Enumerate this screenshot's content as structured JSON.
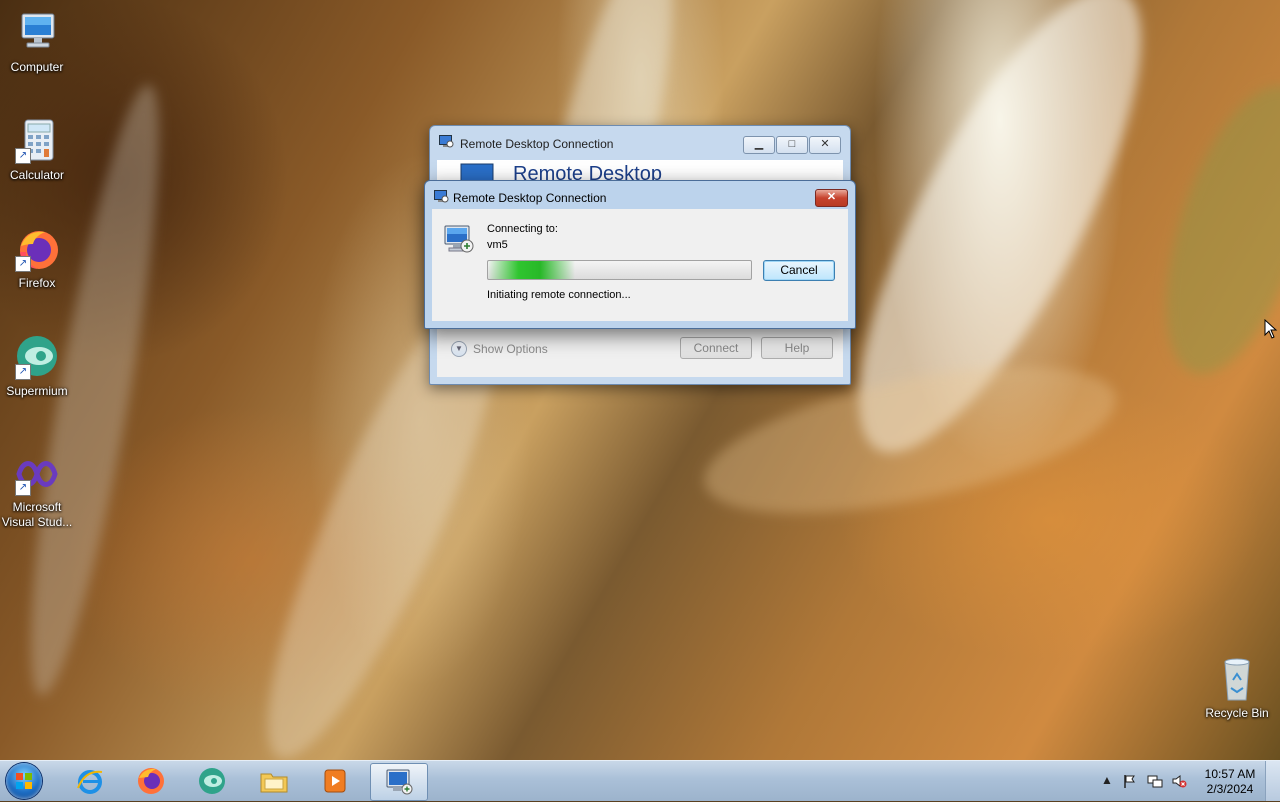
{
  "desktop": {
    "icons": [
      {
        "label": "Computer",
        "icon": "computer-icon"
      },
      {
        "label": "Calculator",
        "icon": "calculator-icon"
      },
      {
        "label": "Firefox",
        "icon": "firefox-icon"
      },
      {
        "label": "Supermium",
        "icon": "supermium-icon"
      },
      {
        "label": "Microsoft Visual Stud...",
        "label_line1": "Microsoft",
        "label_line2": "Visual Stud...",
        "icon": "visual-studio-icon"
      },
      {
        "label": "Recycle Bin",
        "icon": "recycle-bin-icon"
      }
    ]
  },
  "bg_window": {
    "title": "Remote Desktop Connection",
    "heading": "Remote Desktop",
    "show_options": "Show Options",
    "connect_label": "Connect",
    "help_label": "Help"
  },
  "dialog": {
    "title": "Remote Desktop Connection",
    "connecting_label": "Connecting to:",
    "host": "vm5",
    "progress_fraction": 0.33,
    "cancel_label": "Cancel",
    "status": "Initiating remote connection..."
  },
  "taskbar": {
    "pinned": [
      "internet-explorer-icon",
      "firefox-icon",
      "supermium-icon",
      "file-explorer-icon",
      "media-player-icon",
      "remote-desktop-icon"
    ],
    "active_app": "remote-desktop-icon",
    "time": "10:57 AM",
    "date": "2/3/2024"
  },
  "colors": {
    "dialog_frame": "#bcd3ec",
    "progress_green": "#2fc52f",
    "heading_blue": "#1c3f8a"
  }
}
